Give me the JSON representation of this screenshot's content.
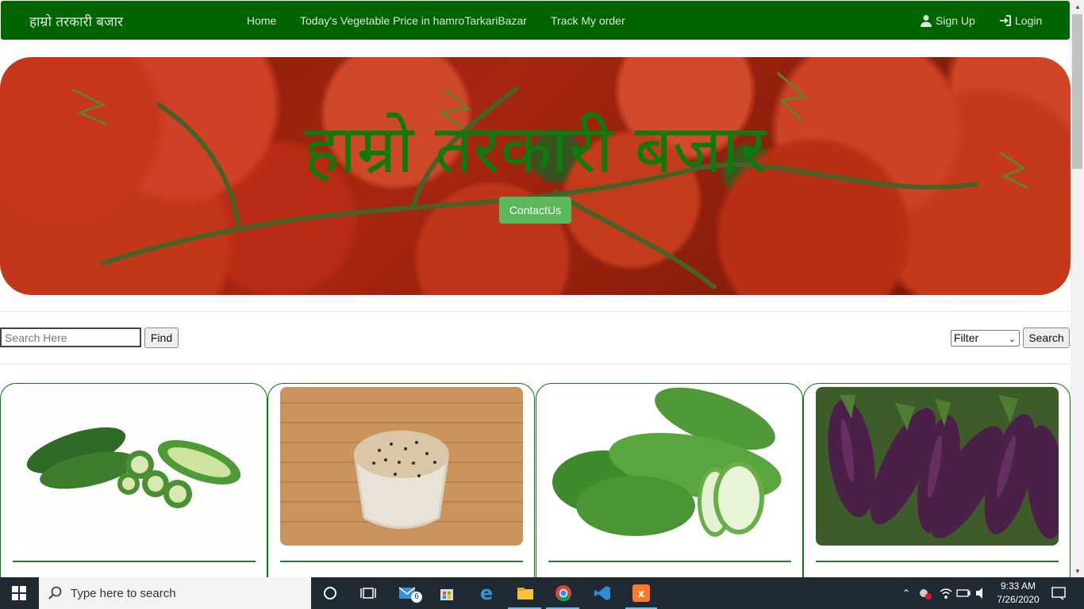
{
  "navbar": {
    "brand": "हाम्रो तरकारी बजार",
    "links": [
      "Home",
      "Today's Vegetable Price in hamroTarkariBazar",
      "Track My order"
    ],
    "signup": "Sign Up",
    "login": "Login",
    "color": "#006400"
  },
  "hero": {
    "title": "हाम्रो तरकारी बजार",
    "contact_button": "ContactUs",
    "title_color": "#0c7a0c",
    "button_color": "#5cb85c"
  },
  "search": {
    "placeholder": "Search Here",
    "find_button": "Find",
    "filter_value": "Filter",
    "search_button": "Search"
  },
  "products": [
    {
      "name": "bitter-gourd"
    },
    {
      "name": "black-eyed-beans"
    },
    {
      "name": "bottle-gourd"
    },
    {
      "name": "eggplant"
    }
  ],
  "taskbar": {
    "search_placeholder": "Type here to search",
    "mail_badge": "6",
    "time": "9:33 AM",
    "date": "7/26/2020"
  }
}
